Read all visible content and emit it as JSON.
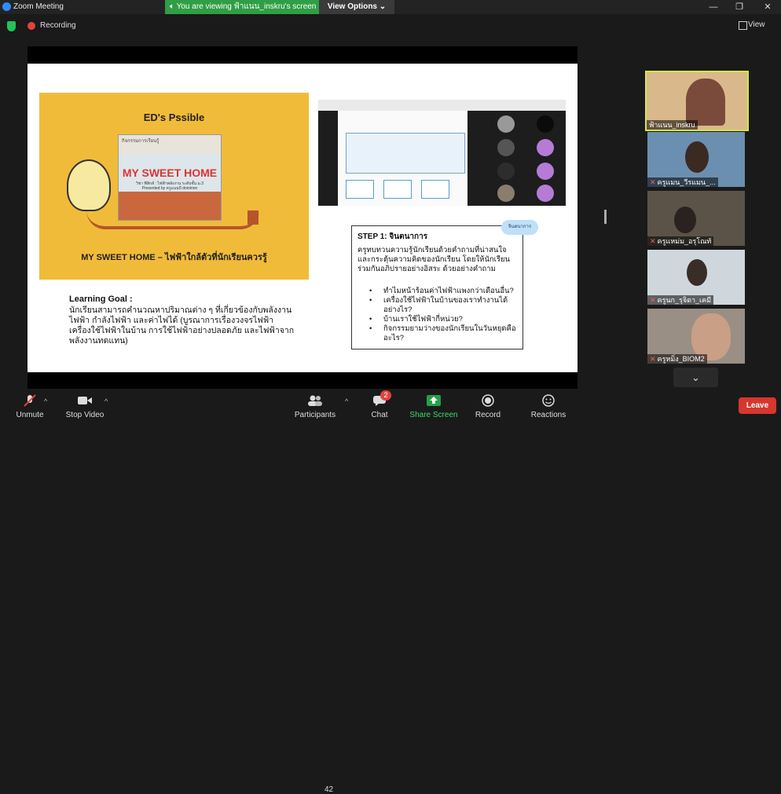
{
  "app": {
    "title": "Zoom Meeting"
  },
  "banner": {
    "viewing": "You are viewing ฟ้าแนน_inskru's screen",
    "view_options": "View Options"
  },
  "window": {
    "minimize": "—",
    "restore": "❐",
    "close": "✕"
  },
  "status": {
    "recording": "Recording",
    "view": "View"
  },
  "slide": {
    "card_title": "ED's Pssible",
    "poster_header": "กิจกรรมการเรียนรู้",
    "poster_title": "MY SWEET HOME",
    "poster_sub": "วิชา ฟิสิกส์ : ไฟฟ้าพลังงาน  ระดับชั้น ม.3",
    "poster_by": "Presented by ครูแนนบี dominnn",
    "card_subtitle": "MY SWEET HOME – ไฟฟ้าใกล้ตัวที่นักเรียนควรรู้",
    "learning_goal_title": "Learning Goal :",
    "learning_goal_text": "นักเรียนสามารถคำนวณหาปริมาณต่าง ๆ ที่เกี่ยวข้องกับพลังงานไฟฟ้า กำลังไฟฟ้า และค่าไฟได้ (บูรณาการเรื่องวงจรไฟฟ้า เครื่องใช้ไฟฟ้าในบ้าน การใช้ไฟฟ้าอย่างปลอดภัย และไฟฟ้าจากพลังงานทดแทน)",
    "cloud_label": "จินตนาการ",
    "step_title": "STEP 1: จินตนาการ",
    "step_body": "ครูทบทวนความรู้นักเรียนด้วยคำถามที่น่าสนใจ และกระตุ้นความคิดของนักเรียน โดยให้นักเรียนร่วมกันอภิปรายอย่างอิสระ ด้วยอย่างคำถาม",
    "step_items": [
      "ทำไมหน้าร้อนค่าไฟฟ้าแพงกว่าเดือนอื่น?",
      "เครื่องใช้ไฟฟ้าในบ้านของเราทำงานได้อย่างไร?",
      "บ้านเราใช้ไฟฟ้ากี่หน่วย?",
      "กิจกรรมยามว่างของนักเรียนในวันหยุดคืออะไร?"
    ]
  },
  "participants": [
    {
      "name": "ฟ้าแนน_inskru",
      "muted": false,
      "active": true
    },
    {
      "name": "ครูแมน_วีรแมน_...",
      "muted": true,
      "active": false
    },
    {
      "name": "ครูแหม่ม_อรุโณทั",
      "muted": true,
      "active": false
    },
    {
      "name": "ครูนก_รุจิดา_เคมี",
      "muted": true,
      "active": false
    },
    {
      "name": "ครูหมิ่ง_BIOM2",
      "muted": true,
      "active": false
    }
  ],
  "toolbar": {
    "unmute": "Unmute",
    "stop_video": "Stop Video",
    "participants": "Participants",
    "participant_count": "42",
    "chat": "Chat",
    "chat_badge": "2",
    "share_screen": "Share Screen",
    "record": "Record",
    "reactions": "Reactions",
    "leave": "Leave"
  }
}
